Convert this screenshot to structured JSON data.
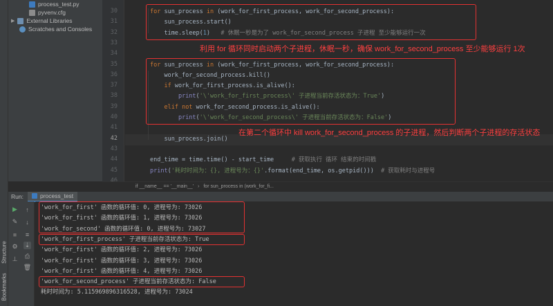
{
  "project_tree": {
    "items": [
      {
        "label": "process_test.py",
        "icon": "python-file-icon"
      },
      {
        "label": "pyvenv.cfg",
        "icon": "config-file-icon"
      },
      {
        "label": "External Libraries",
        "icon": "library-icon"
      },
      {
        "label": "Scratches and Consoles",
        "icon": "scratches-icon"
      }
    ]
  },
  "editor": {
    "line_numbers": [
      "30",
      "31",
      "32",
      "33",
      "34",
      "35",
      "36",
      "37",
      "38",
      "39",
      "40",
      "41",
      "42",
      "43",
      "44",
      "45",
      "46"
    ],
    "current_line": "42",
    "code_lines": [
      {
        "t": [
          [
            "kw",
            "for "
          ],
          [
            "p",
            "sun_process "
          ],
          [
            "kw",
            "in "
          ],
          [
            "p",
            "(work_for_first_process, work_for_second_process):"
          ]
        ]
      },
      {
        "t": [
          [
            "p",
            "    sun_process.start()"
          ]
        ]
      },
      {
        "t": [
          [
            "p",
            "    time.sleep("
          ],
          [
            "num",
            "1"
          ],
          [
            "p",
            ")   "
          ],
          [
            "cmt",
            "# 休眠一秒是为了 work_for_second_process 子进程 至少能够运行一次"
          ]
        ]
      },
      {
        "t": []
      },
      {
        "t": []
      },
      {
        "t": [
          [
            "kw",
            "for "
          ],
          [
            "p",
            "sun_process "
          ],
          [
            "kw",
            "in "
          ],
          [
            "p",
            "(work_for_first_process, work_for_second_process):"
          ]
        ]
      },
      {
        "t": [
          [
            "p",
            "    work_for_second_process.kill()"
          ]
        ]
      },
      {
        "t": [
          [
            "p",
            "    "
          ],
          [
            "kw",
            "if "
          ],
          [
            "p",
            "work_for_first_process.is_alive():"
          ]
        ]
      },
      {
        "t": [
          [
            "p",
            "        "
          ],
          [
            "bi",
            "print"
          ],
          [
            "p",
            "("
          ],
          [
            "str",
            "'\\'work_for_first_process\\' 子进程当前存活状态为：True'"
          ],
          [
            "p",
            ")"
          ]
        ]
      },
      {
        "t": [
          [
            "p",
            "    "
          ],
          [
            "kw",
            "elif not "
          ],
          [
            "p",
            "work_for_second_process.is_alive():"
          ]
        ]
      },
      {
        "t": [
          [
            "p",
            "        "
          ],
          [
            "bi",
            "print"
          ],
          [
            "p",
            "("
          ],
          [
            "str",
            "'\\'work_for_second_process\\' 子进程当前存活状态为：False'"
          ],
          [
            "p",
            ")"
          ]
        ]
      },
      {
        "t": []
      },
      {
        "t": [
          [
            "p",
            "    sun_process.join()"
          ]
        ]
      },
      {
        "t": []
      },
      {
        "t": [
          [
            "p",
            "end_time = time.time() - start_time     "
          ],
          [
            "cmt",
            "# 获取执行 循环 结束的时间戳"
          ]
        ]
      },
      {
        "t": [
          [
            "bi",
            "print"
          ],
          [
            "p",
            "("
          ],
          [
            "str",
            "'耗时时间为：{}, 进程号为：{}'"
          ],
          [
            "p",
            ".format(end_time, os.getpid()))  "
          ],
          [
            "cmt",
            "# 获取耗时与进程号"
          ]
        ]
      },
      {
        "t": []
      }
    ],
    "annotation_1": "利用 for 循环同时启动两个子进程，休眠一秒，确保 work_for_second_process 至少能够运行 1次",
    "annotation_2": "在第二个循环中 kill work_for_second_process 的子进程，然后判断两个子进程的存活状态"
  },
  "breadcrumb": {
    "items": [
      "if __name__ == '__main__'",
      "for sun_process in (work_for_fi..."
    ]
  },
  "run_panel": {
    "label": "Run:",
    "tab": "process_test"
  },
  "console": {
    "lines": [
      "'work_for_first' 函数的循环值: 0, 进程号为: 73026",
      "'work_for_first' 函数的循环值: 1, 进程号为: 73026",
      "'work_for_second' 函数的循环值: 0, 进程号为: 73027",
      "'work_for_first_process' 子进程当前存活状态为: True",
      "'work_for_first' 函数的循环值: 2, 进程号为: 73026",
      "'work_for_first' 函数的循环值: 3, 进程号为: 73026",
      "'work_for_first' 函数的循环值: 4, 进程号为: 73026",
      "'work_for_second_process' 子进程当前存活状态为: False",
      "耗时时间为: 5.115969896316528, 进程号为: 73024"
    ]
  },
  "side_labels": {
    "structure": "Structure",
    "bookmarks": "Bookmarks"
  },
  "colors": {
    "accent": "#4a88c7",
    "annotation_red": "#e53232",
    "keyword": "#cc7832",
    "string": "#6a8759"
  }
}
